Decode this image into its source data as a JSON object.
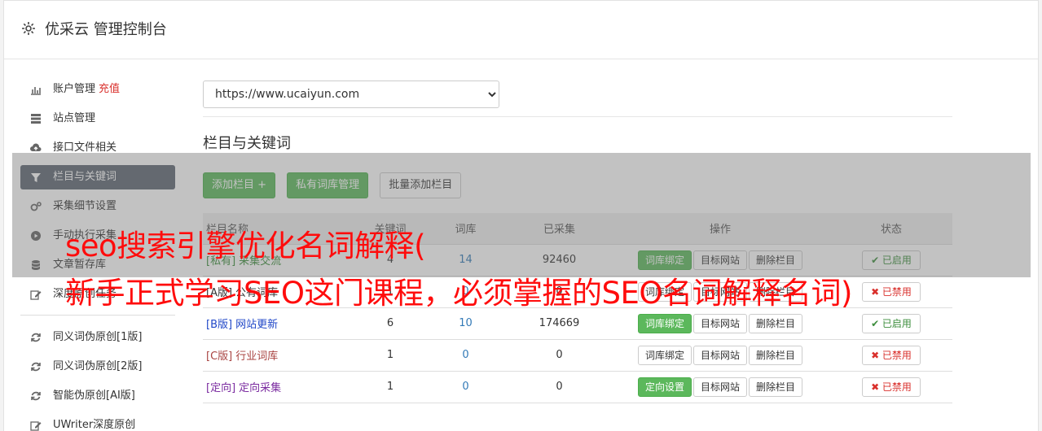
{
  "header": {
    "title": "优采云 管理控制台"
  },
  "sidebar": {
    "items": [
      {
        "label": "账户管理",
        "badge": "充值",
        "icon": "bar-chart-icon"
      },
      {
        "label": "站点管理",
        "icon": "server-icon"
      },
      {
        "label": "接口文件相关",
        "icon": "cloud-upload-icon"
      },
      {
        "label": "栏目与关键词",
        "icon": "filter-icon",
        "active": true
      },
      {
        "label": "采集细节设置",
        "icon": "cogs-icon"
      },
      {
        "label": "手动执行采集",
        "icon": "play-circle-icon"
      },
      {
        "label": "文章暂存库",
        "icon": "database-icon"
      },
      {
        "label": "深度原创任务",
        "icon": "edit-icon"
      }
    ],
    "items2": [
      {
        "label": "同义词伪原创[1版]",
        "icon": "refresh-icon"
      },
      {
        "label": "同义词伪原创[2版]",
        "icon": "refresh-icon"
      },
      {
        "label": "智能伪原创[AI版]",
        "icon": "refresh-icon"
      },
      {
        "label": "UWriter深度原创",
        "icon": "edit-icon"
      }
    ]
  },
  "main": {
    "site_select": "https://www.ucaiyun.com",
    "section_title": "栏目与关键词",
    "buttons": {
      "add": "添加栏目 +",
      "private": "私有词库管理",
      "batch": "批量添加栏目"
    },
    "table": {
      "headers": [
        "栏目名称",
        "关键词",
        "词库",
        "已采集",
        "操作",
        "状态"
      ],
      "rows": [
        {
          "tag": "[私有]",
          "name": "采集交流",
          "kw": "4",
          "lib": "14",
          "collected": "92460",
          "op1": "词库绑定",
          "op2": "目标网站",
          "op3": "删除栏目",
          "status": "✔ 已启用",
          "cls": "c-private",
          "op1_green": true,
          "on": true
        },
        {
          "tag": "[A版]",
          "name": "公有词库",
          "kw": "1",
          "lib": "0",
          "collected": "0",
          "op1": "词库绑定",
          "op2": "目标网站",
          "op3": "删除栏目",
          "status": "✖ 已禁用",
          "cls": "c-a",
          "op1_green": false,
          "on": false
        },
        {
          "tag": "[B版]",
          "name": "网站更新",
          "kw": "6",
          "lib": "10",
          "collected": "174669",
          "op1": "词库绑定",
          "op2": "目标网站",
          "op3": "删除栏目",
          "status": "✔ 已启用",
          "cls": "c-b",
          "op1_green": true,
          "on": true
        },
        {
          "tag": "[C版]",
          "name": "行业词库",
          "kw": "1",
          "lib": "0",
          "collected": "0",
          "op1": "词库绑定",
          "op2": "目标网站",
          "op3": "删除栏目",
          "status": "✖ 已禁用",
          "cls": "c-c",
          "op1_green": false,
          "on": false
        },
        {
          "tag": "[定向]",
          "name": "定向采集",
          "kw": "1",
          "lib": "0",
          "collected": "0",
          "op1": "定向设置",
          "op2": "目标网站",
          "op3": "删除栏目",
          "status": "✖ 已禁用",
          "cls": "c-dir",
          "op1_green": true,
          "on": false
        }
      ]
    }
  },
  "overlay": {
    "line1": "seo搜索引擎优化名词解释(",
    "line2": "新手正式学习SEO这门课程，必须掌握的SEO名词解释名词)"
  }
}
